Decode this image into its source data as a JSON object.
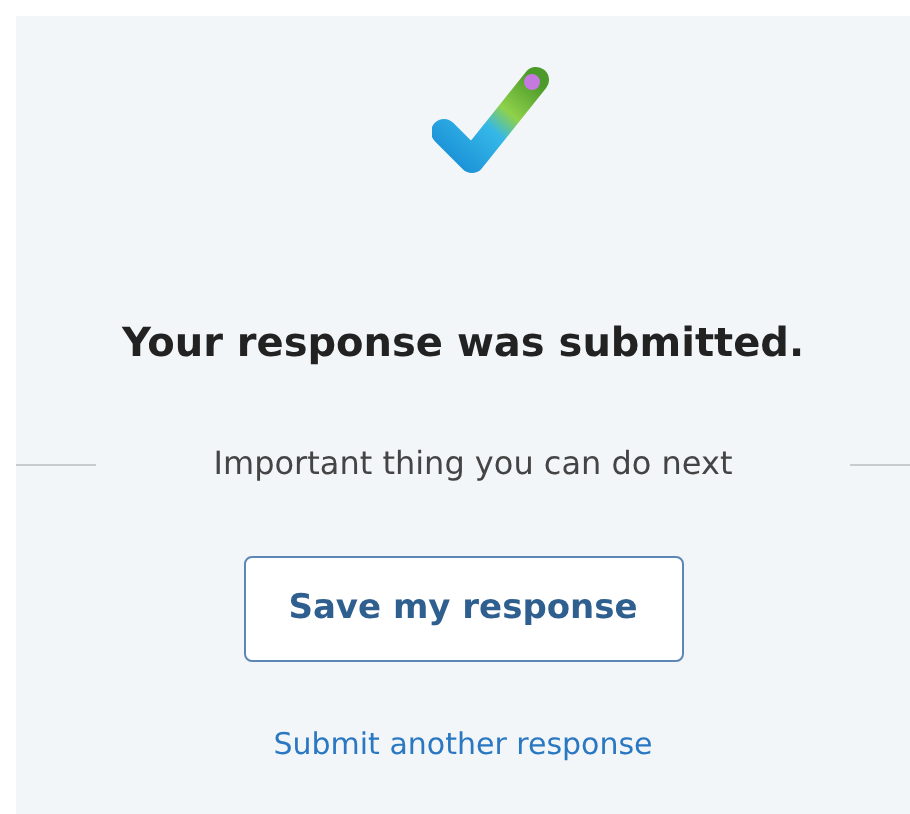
{
  "confirmation": {
    "title": "Your response was submitted.",
    "next_steps_heading": "Important thing you can do next",
    "save_button": "Save my response",
    "submit_another_link": "Submit another response"
  }
}
